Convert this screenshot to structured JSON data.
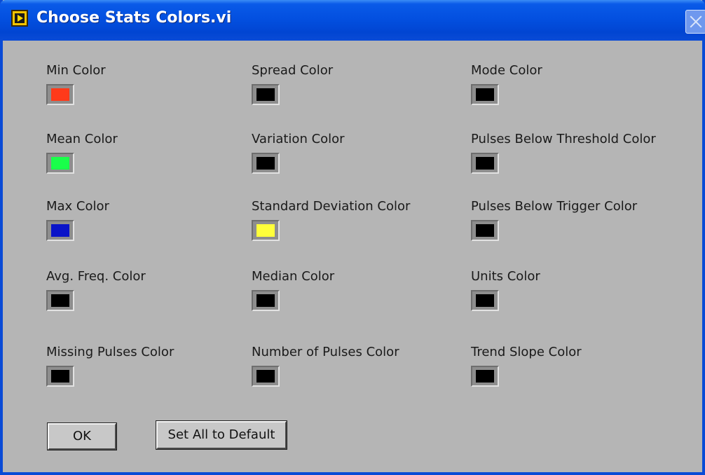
{
  "window": {
    "title": "Choose Stats Colors.vi"
  },
  "fields": [
    {
      "label": "Min Color",
      "color": "#ff3a1a"
    },
    {
      "label": "Spread Color",
      "color": "#000000"
    },
    {
      "label": "Mode Color",
      "color": "#000000"
    },
    {
      "label": "Mean Color",
      "color": "#19ff4a"
    },
    {
      "label": "Variation Color",
      "color": "#000000"
    },
    {
      "label": "Pulses Below Threshold Color",
      "color": "#000000"
    },
    {
      "label": "Max Color",
      "color": "#0a14c8"
    },
    {
      "label": "Standard Deviation Color",
      "color": "#ffff3a"
    },
    {
      "label": "Pulses Below Trigger Color",
      "color": "#000000"
    },
    {
      "label": "Avg. Freq. Color",
      "color": "#000000"
    },
    {
      "label": "Median Color",
      "color": "#000000"
    },
    {
      "label": "Units Color",
      "color": "#000000"
    },
    {
      "label": "Missing Pulses Color",
      "color": "#000000"
    },
    {
      "label": "Number of Pulses Color",
      "color": "#000000"
    },
    {
      "label": "Trend Slope Color",
      "color": "#000000"
    }
  ],
  "buttons": {
    "ok": "OK",
    "set_default": "Set All to Default"
  }
}
